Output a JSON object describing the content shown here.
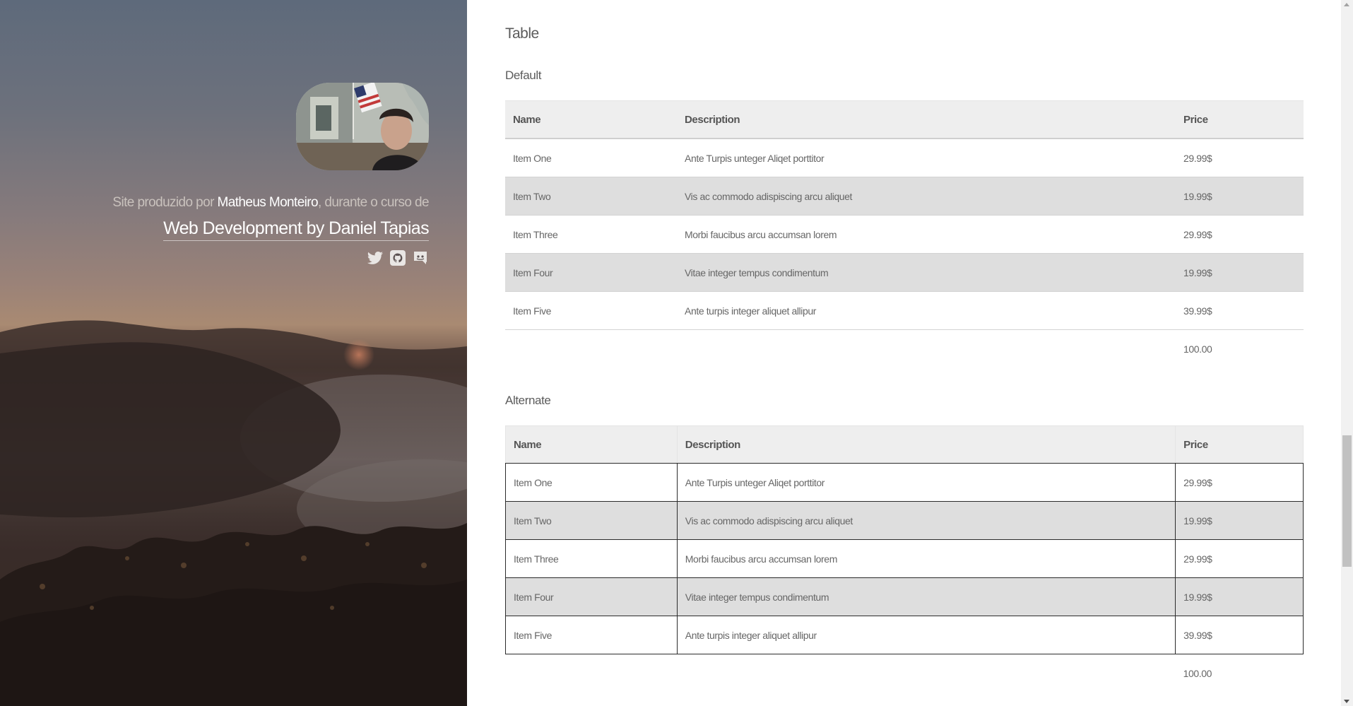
{
  "sidebar": {
    "credit_prefix": "Site produzido por ",
    "author": "Matheus Monteiro",
    "credit_suffix": ", durante o curso de",
    "course_link": "Web Development by Daniel Tapias",
    "social_icons": [
      "twitter-icon",
      "github-icon",
      "discord-icon"
    ]
  },
  "main": {
    "section_title": "Table",
    "default_title": "Default",
    "alternate_title": "Alternate",
    "columns": [
      "Name",
      "Description",
      "Price"
    ],
    "rows": [
      {
        "name": "Item One",
        "description": "Ante Turpis unteger Aliqet porttitor",
        "price": "29.99$"
      },
      {
        "name": "Item Two",
        "description": "Vis ac commodo adispiscing arcu aliquet",
        "price": "19.99$"
      },
      {
        "name": "Item Three",
        "description": "Morbi faucibus arcu accumsan lorem",
        "price": "29.99$"
      },
      {
        "name": "Item Four",
        "description": "Vitae integer tempus condimentum",
        "price": "19.99$"
      },
      {
        "name": "Item Five",
        "description": "Ante turpis integer aliquet allipur",
        "price": "39.99$"
      }
    ],
    "total": "100.00"
  },
  "colors": {
    "row_alt": "#dedede",
    "header_bg": "#eeeeee",
    "text": "#6c6c6c"
  }
}
